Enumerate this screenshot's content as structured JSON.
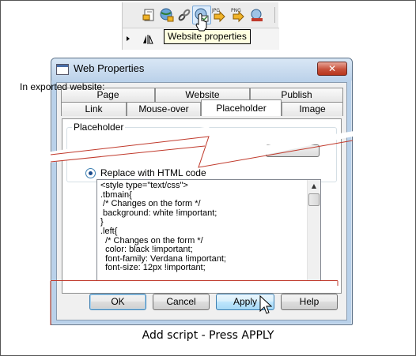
{
  "toolbar": {
    "buttons": [
      {
        "name": "page-icon"
      },
      {
        "name": "globe-icon"
      },
      {
        "name": "link-icon"
      },
      {
        "name": "website-properties-icon"
      },
      {
        "name": "jpg-export-icon",
        "label": "JPG"
      },
      {
        "name": "png-export-icon",
        "label": "PNG"
      },
      {
        "name": "preview-icon"
      }
    ],
    "tooltip": "Website properties"
  },
  "dialog": {
    "title": "Web Properties",
    "close_glyph": "✕",
    "tabs_back": [
      "Page",
      "Website",
      "Publish"
    ],
    "tabs_front": [
      "Link",
      "Mouse-over",
      "Placeholder",
      "Image"
    ],
    "active_tab": "Placeholder",
    "group_label": "Placeholder",
    "exported_text": "In exported website:",
    "radio_label": "Replace with HTML code",
    "code": "<style type=\"text/css\">\n.tbmain{\n /* Changes on the form */\n background: white !important;\n}\n.left{\n  /* Changes on the form */\n  color: black !important;\n  font-family: Verdana !important;\n  font-size: 12px !important;",
    "buttons": {
      "ok": "OK",
      "cancel": "Cancel",
      "apply": "Apply",
      "help": "Help"
    }
  },
  "caption": "Add script - Press APPLY",
  "colors": {
    "dialog_frame": "#b9d1ea",
    "tear_line": "#c0392b",
    "tooltip_bg": "#ffffe1"
  }
}
